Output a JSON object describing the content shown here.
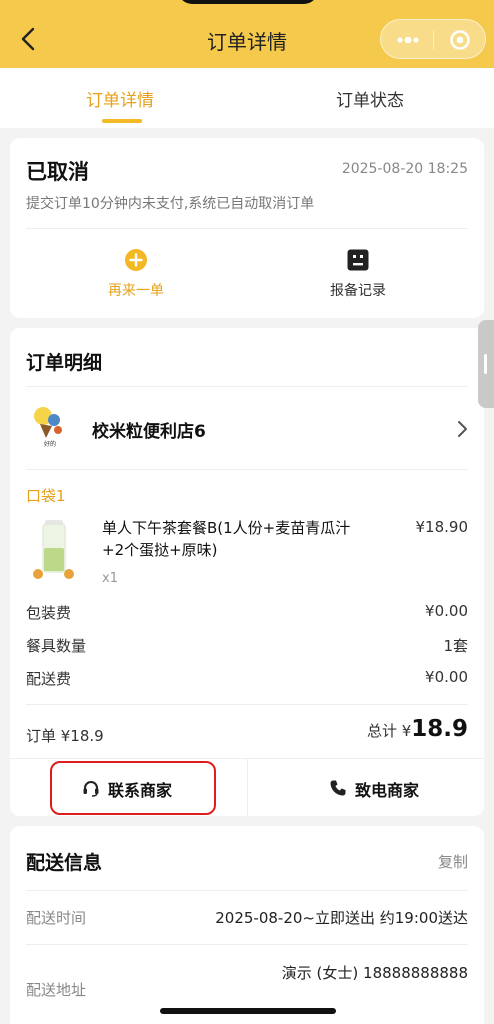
{
  "header": {
    "title": "订单详情"
  },
  "tabs": [
    {
      "label": "订单详情",
      "active": true
    },
    {
      "label": "订单状态",
      "active": false
    }
  ],
  "status": {
    "title": "已取消",
    "time": "2025-08-20 18:25",
    "description": "提交订单10分钟内未支付,系统已自动取消订单",
    "actions": [
      {
        "label": "再来一单",
        "icon": "plus-circle-icon"
      },
      {
        "label": "报备记录",
        "icon": "record-icon"
      }
    ]
  },
  "order_detail": {
    "heading": "订单明细",
    "shop": {
      "name": "校米粒便利店6",
      "logo_text": "好的"
    },
    "bag_label": "口袋1",
    "item": {
      "name": "单人下午茶套餐B(1人份+麦苗青瓜汁+2个蛋挞+原味)",
      "price": "¥18.90",
      "qty": "x1"
    },
    "fees": [
      {
        "label": "包装费",
        "value": "¥0.00"
      },
      {
        "label": "餐具数量",
        "value": "1套"
      },
      {
        "label": "配送费",
        "value": "¥0.00"
      }
    ],
    "order_sum": "订单 ¥18.9",
    "total_label": "总计 ¥",
    "total_value": "18.9",
    "buttons": {
      "contact": "联系商家",
      "call": "致电商家"
    }
  },
  "delivery": {
    "heading": "配送信息",
    "copy": "复制",
    "rows": [
      {
        "label": "配送时间",
        "value": "2025-08-20~立即送出 约19:00送达"
      },
      {
        "label": "配送地址",
        "value": "演示 (女士) 18888888888"
      }
    ]
  },
  "colors": {
    "brand_yellow": "#f5c94b",
    "accent_orange": "#e6a21b",
    "highlight_red": "#e01d1d"
  }
}
